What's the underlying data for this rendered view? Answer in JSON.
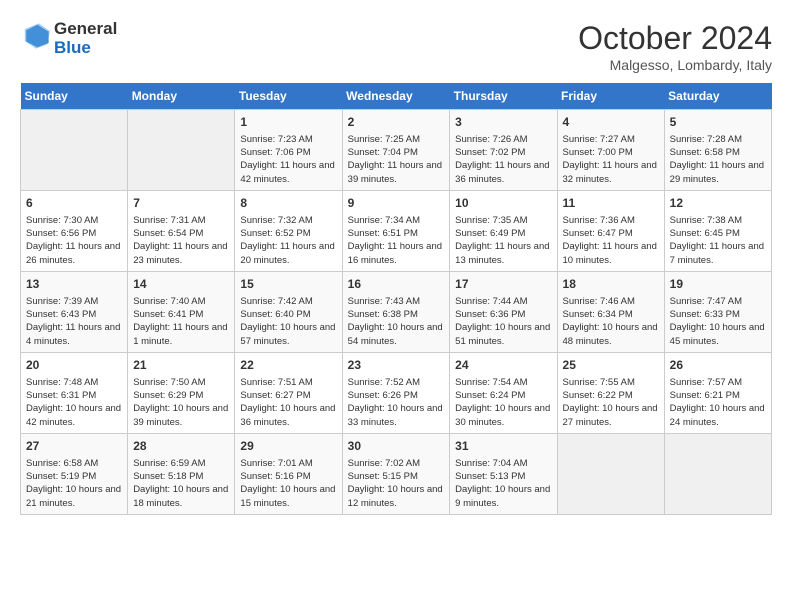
{
  "header": {
    "logo_line1": "General",
    "logo_line2": "Blue",
    "title": "October 2024",
    "subtitle": "Malgesso, Lombardy, Italy"
  },
  "columns": [
    "Sunday",
    "Monday",
    "Tuesday",
    "Wednesday",
    "Thursday",
    "Friday",
    "Saturday"
  ],
  "weeks": [
    [
      {
        "day": "",
        "info": ""
      },
      {
        "day": "",
        "info": ""
      },
      {
        "day": "1",
        "info": "Sunrise: 7:23 AM\nSunset: 7:06 PM\nDaylight: 11 hours and 42 minutes."
      },
      {
        "day": "2",
        "info": "Sunrise: 7:25 AM\nSunset: 7:04 PM\nDaylight: 11 hours and 39 minutes."
      },
      {
        "day": "3",
        "info": "Sunrise: 7:26 AM\nSunset: 7:02 PM\nDaylight: 11 hours and 36 minutes."
      },
      {
        "day": "4",
        "info": "Sunrise: 7:27 AM\nSunset: 7:00 PM\nDaylight: 11 hours and 32 minutes."
      },
      {
        "day": "5",
        "info": "Sunrise: 7:28 AM\nSunset: 6:58 PM\nDaylight: 11 hours and 29 minutes."
      }
    ],
    [
      {
        "day": "6",
        "info": "Sunrise: 7:30 AM\nSunset: 6:56 PM\nDaylight: 11 hours and 26 minutes."
      },
      {
        "day": "7",
        "info": "Sunrise: 7:31 AM\nSunset: 6:54 PM\nDaylight: 11 hours and 23 minutes."
      },
      {
        "day": "8",
        "info": "Sunrise: 7:32 AM\nSunset: 6:52 PM\nDaylight: 11 hours and 20 minutes."
      },
      {
        "day": "9",
        "info": "Sunrise: 7:34 AM\nSunset: 6:51 PM\nDaylight: 11 hours and 16 minutes."
      },
      {
        "day": "10",
        "info": "Sunrise: 7:35 AM\nSunset: 6:49 PM\nDaylight: 11 hours and 13 minutes."
      },
      {
        "day": "11",
        "info": "Sunrise: 7:36 AM\nSunset: 6:47 PM\nDaylight: 11 hours and 10 minutes."
      },
      {
        "day": "12",
        "info": "Sunrise: 7:38 AM\nSunset: 6:45 PM\nDaylight: 11 hours and 7 minutes."
      }
    ],
    [
      {
        "day": "13",
        "info": "Sunrise: 7:39 AM\nSunset: 6:43 PM\nDaylight: 11 hours and 4 minutes."
      },
      {
        "day": "14",
        "info": "Sunrise: 7:40 AM\nSunset: 6:41 PM\nDaylight: 11 hours and 1 minute."
      },
      {
        "day": "15",
        "info": "Sunrise: 7:42 AM\nSunset: 6:40 PM\nDaylight: 10 hours and 57 minutes."
      },
      {
        "day": "16",
        "info": "Sunrise: 7:43 AM\nSunset: 6:38 PM\nDaylight: 10 hours and 54 minutes."
      },
      {
        "day": "17",
        "info": "Sunrise: 7:44 AM\nSunset: 6:36 PM\nDaylight: 10 hours and 51 minutes."
      },
      {
        "day": "18",
        "info": "Sunrise: 7:46 AM\nSunset: 6:34 PM\nDaylight: 10 hours and 48 minutes."
      },
      {
        "day": "19",
        "info": "Sunrise: 7:47 AM\nSunset: 6:33 PM\nDaylight: 10 hours and 45 minutes."
      }
    ],
    [
      {
        "day": "20",
        "info": "Sunrise: 7:48 AM\nSunset: 6:31 PM\nDaylight: 10 hours and 42 minutes."
      },
      {
        "day": "21",
        "info": "Sunrise: 7:50 AM\nSunset: 6:29 PM\nDaylight: 10 hours and 39 minutes."
      },
      {
        "day": "22",
        "info": "Sunrise: 7:51 AM\nSunset: 6:27 PM\nDaylight: 10 hours and 36 minutes."
      },
      {
        "day": "23",
        "info": "Sunrise: 7:52 AM\nSunset: 6:26 PM\nDaylight: 10 hours and 33 minutes."
      },
      {
        "day": "24",
        "info": "Sunrise: 7:54 AM\nSunset: 6:24 PM\nDaylight: 10 hours and 30 minutes."
      },
      {
        "day": "25",
        "info": "Sunrise: 7:55 AM\nSunset: 6:22 PM\nDaylight: 10 hours and 27 minutes."
      },
      {
        "day": "26",
        "info": "Sunrise: 7:57 AM\nSunset: 6:21 PM\nDaylight: 10 hours and 24 minutes."
      }
    ],
    [
      {
        "day": "27",
        "info": "Sunrise: 6:58 AM\nSunset: 5:19 PM\nDaylight: 10 hours and 21 minutes."
      },
      {
        "day": "28",
        "info": "Sunrise: 6:59 AM\nSunset: 5:18 PM\nDaylight: 10 hours and 18 minutes."
      },
      {
        "day": "29",
        "info": "Sunrise: 7:01 AM\nSunset: 5:16 PM\nDaylight: 10 hours and 15 minutes."
      },
      {
        "day": "30",
        "info": "Sunrise: 7:02 AM\nSunset: 5:15 PM\nDaylight: 10 hours and 12 minutes."
      },
      {
        "day": "31",
        "info": "Sunrise: 7:04 AM\nSunset: 5:13 PM\nDaylight: 10 hours and 9 minutes."
      },
      {
        "day": "",
        "info": ""
      },
      {
        "day": "",
        "info": ""
      }
    ]
  ]
}
